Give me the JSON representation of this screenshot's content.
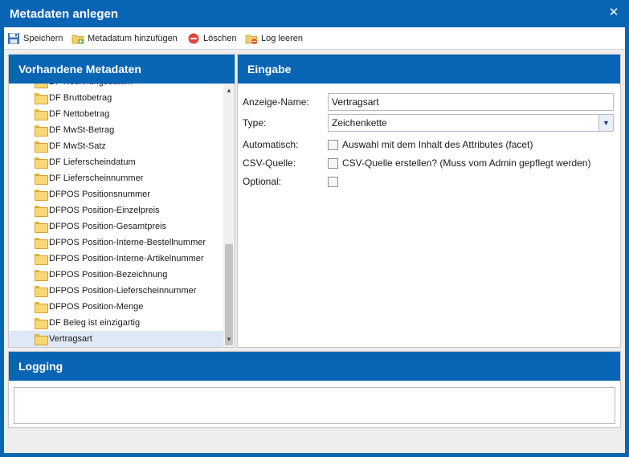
{
  "window": {
    "title": "Metadaten anlegen",
    "close_glyph": "✕"
  },
  "toolbar": {
    "save": {
      "label": "Speichern",
      "icon": "floppy-disk-icon"
    },
    "add": {
      "label": "Metadatum hinzufügen",
      "icon": "folder-add-icon"
    },
    "delete": {
      "label": "Löschen",
      "icon": "delete-icon"
    },
    "clear_log": {
      "label": "Log leeren",
      "icon": "log-clear-icon"
    }
  },
  "left_panel": {
    "title": "Vorhandene Metadaten",
    "items": [
      "DF Rechnungsdatum",
      "DF Bruttobetrag",
      "DF Nettobetrag",
      "DF MwSt-Betrag",
      "DF MwSt-Satz",
      "DF Lieferscheindatum",
      "DF Lieferscheinnummer",
      "DFPOS Positionsnummer",
      "DFPOS Position-Einzelpreis",
      "DFPOS Position-Gesamtpreis",
      "DFPOS Position-Interne-Bestellnummer",
      "DFPOS Position-Interne-Artikelnummer",
      "DFPOS Position-Bezeichnung",
      "DFPOS Position-Lieferscheinnummer",
      "DFPOS Position-Menge",
      "DF Beleg ist einzigartig",
      "Vertragsart"
    ],
    "selected_index": 16
  },
  "right_panel": {
    "title": "Eingabe",
    "fields": {
      "anzeige_name": {
        "label": "Anzeige-Name:",
        "value": "Vertragsart"
      },
      "type": {
        "label": "Type:",
        "value": "Zeichenkette"
      },
      "automatisch": {
        "label": "Automatisch:",
        "checkbox_label": "Auswahl mit dem Inhalt des Attributes (facet)",
        "checked": false
      },
      "csv_quelle": {
        "label": "CSV-Quelle:",
        "checkbox_label": "CSV-Quelle erstellen? (Muss vom Admin gepflegt werden)",
        "checked": false
      },
      "optional": {
        "label": "Optional:",
        "checked": false
      }
    }
  },
  "logging_panel": {
    "title": "Logging",
    "content": ""
  },
  "colors": {
    "header_blue": "#0865b4",
    "selection": "#dfe8f6"
  }
}
